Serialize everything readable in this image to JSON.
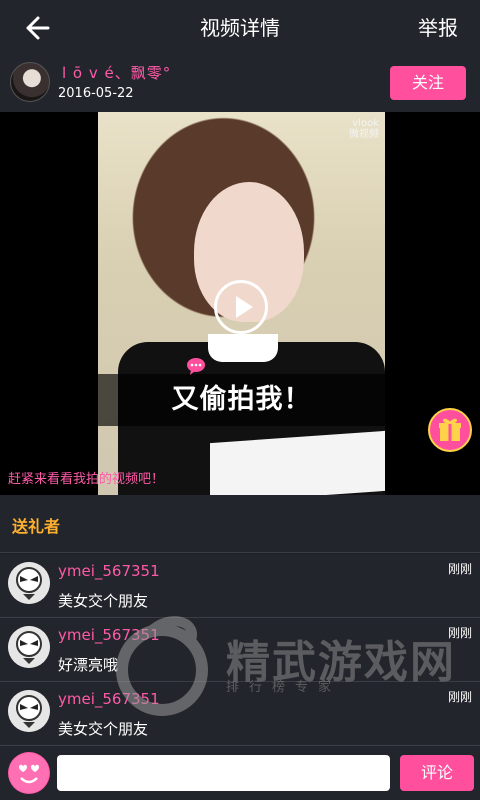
{
  "header": {
    "title": "视频详情",
    "report_label": "举报"
  },
  "author": {
    "name": "l ō v é、飘零°",
    "date": "2016-05-22",
    "follow_label": "关注"
  },
  "video": {
    "caption": "又偷拍我！",
    "watermark": "vlook",
    "watermark_sub": "微视频",
    "promo_text": "赶紧来看看我拍的视频吧！"
  },
  "gifts": {
    "section_label": "送礼者"
  },
  "comments": [
    {
      "user": "ymei_567351",
      "text": "美女交个朋友",
      "time": "刚刚"
    },
    {
      "user": "ymei_567351",
      "text": "好漂亮哦",
      "time": "刚刚"
    },
    {
      "user": "ymei_567351",
      "text": "美女交个朋友",
      "time": "刚刚"
    }
  ],
  "site_watermark": {
    "name": "精武游戏网",
    "sub": "排行榜专家"
  },
  "composer": {
    "placeholder": "",
    "submit_label": "评论"
  },
  "colors": {
    "accent": "#ff4f9d",
    "gold": "#ffb12e",
    "bg": "#1e2026",
    "bar": "#23252c"
  }
}
